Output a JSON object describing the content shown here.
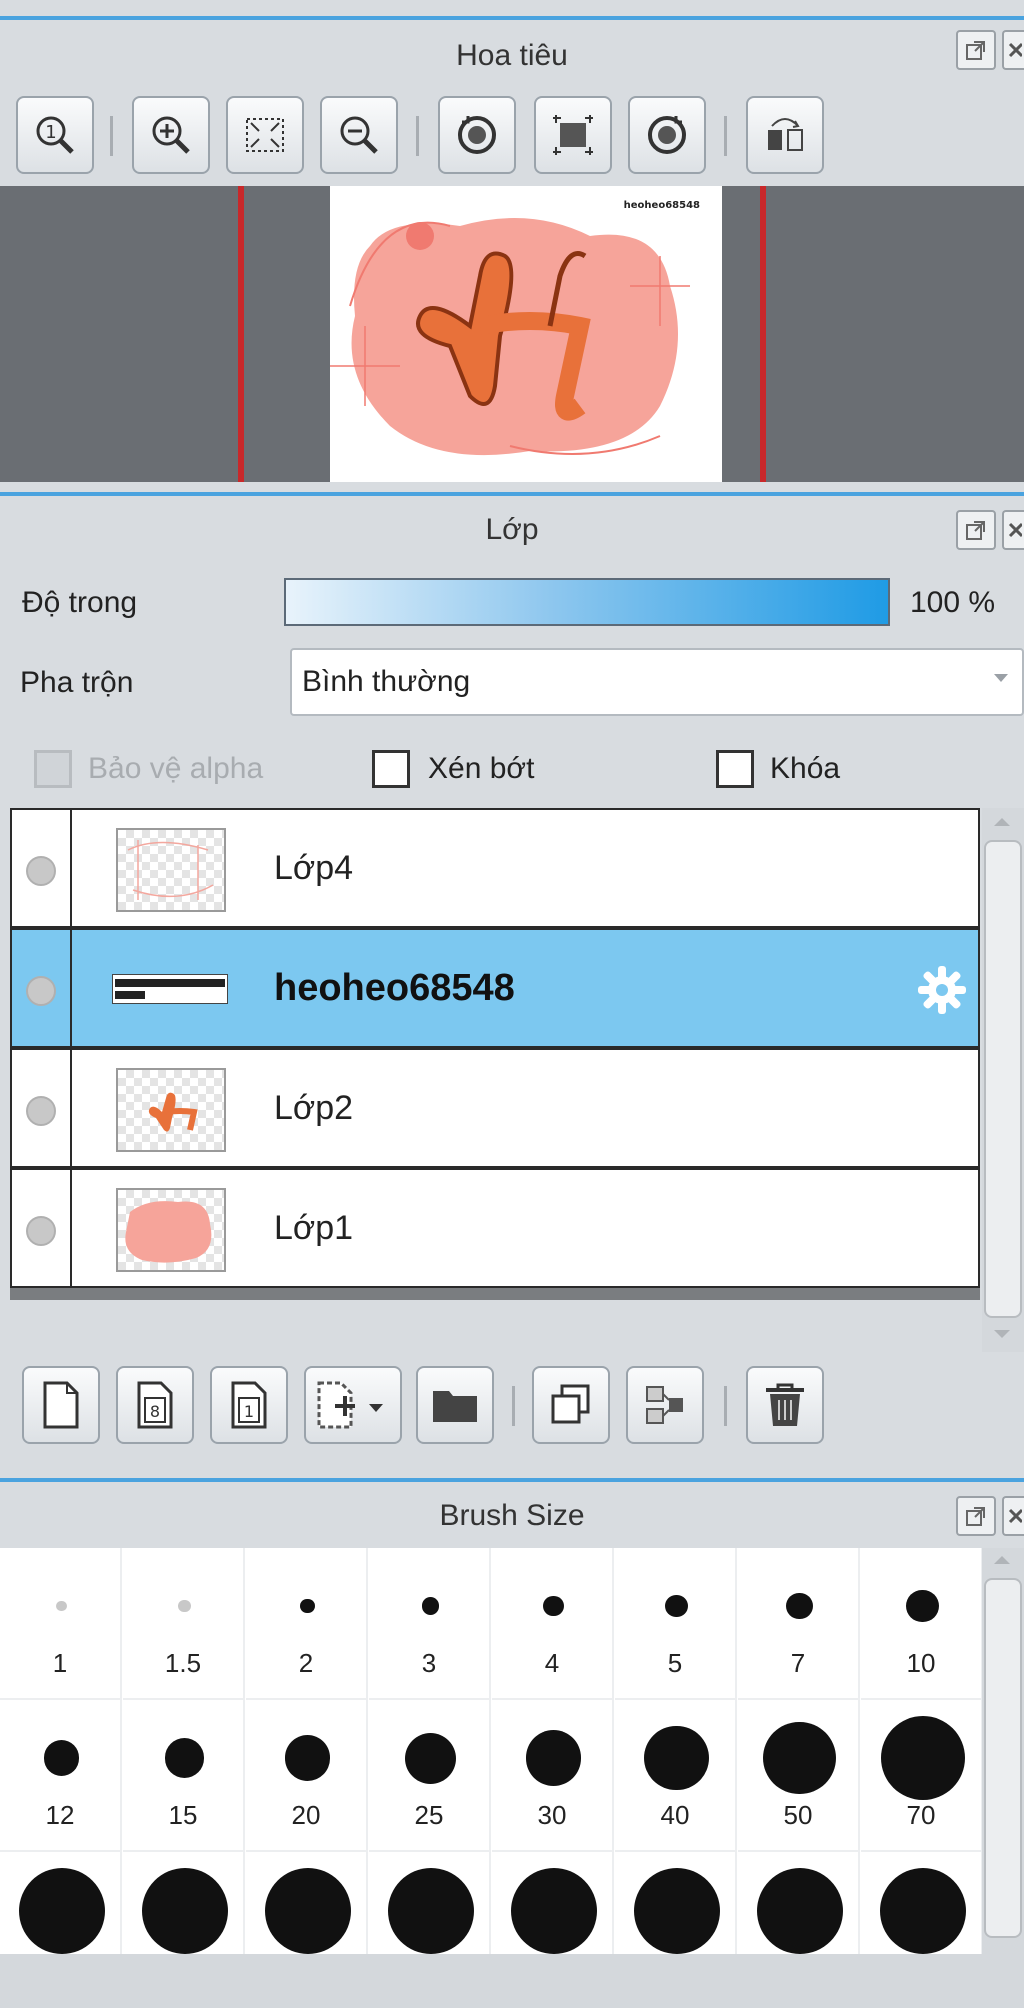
{
  "navigator": {
    "title": "Hoa tiêu",
    "toolbar": [
      {
        "icon": "zoom-actual-icon"
      },
      {
        "icon": "zoom-in-icon"
      },
      {
        "icon": "fit-screen-icon"
      },
      {
        "icon": "zoom-out-icon"
      },
      {
        "icon": "rotate-left-icon"
      },
      {
        "icon": "fit-canvas-icon"
      },
      {
        "icon": "rotate-right-icon"
      },
      {
        "icon": "flip-icon"
      }
    ],
    "preview_text": "heoheo68548"
  },
  "layer_panel": {
    "title": "Lớp",
    "opacity_label": "Độ trong",
    "opacity_value": "100 %",
    "opacity_fraction": 1.0,
    "blend_label": "Pha trộn",
    "blend_value": "Bình thường",
    "protect_alpha_label": "Bảo vệ alpha",
    "clipping_label": "Xén bớt",
    "lock_label": "Khóa",
    "layers": [
      {
        "name": "Lớp4",
        "active": false
      },
      {
        "name": "heoheo68548",
        "active": true
      },
      {
        "name": "Lớp2",
        "active": false
      },
      {
        "name": "Lớp1",
        "active": false
      }
    ],
    "bottom_toolbar": [
      {
        "icon": "new-layer-icon"
      },
      {
        "icon": "new-8bit-layer-icon"
      },
      {
        "icon": "new-1bit-layer-icon"
      },
      {
        "icon": "add-layer-dropdown-icon"
      },
      {
        "icon": "new-folder-icon"
      },
      {
        "icon": "duplicate-layer-icon"
      },
      {
        "icon": "merge-layer-icon"
      },
      {
        "icon": "delete-layer-icon"
      }
    ]
  },
  "brush_size": {
    "title": "Brush Size",
    "sizes": [
      "1",
      "1.5",
      "2",
      "3",
      "4",
      "5",
      "7",
      "10",
      "12",
      "15",
      "20",
      "25",
      "30",
      "40",
      "50",
      "70"
    ]
  },
  "colors": {
    "accent": "#4aa3df",
    "active_layer": "#7cc8f0",
    "canvas_bg": "#6a6e73",
    "guide_red": "#c8282a",
    "salmon": "#f6a49a",
    "orange": "#e8713a"
  }
}
